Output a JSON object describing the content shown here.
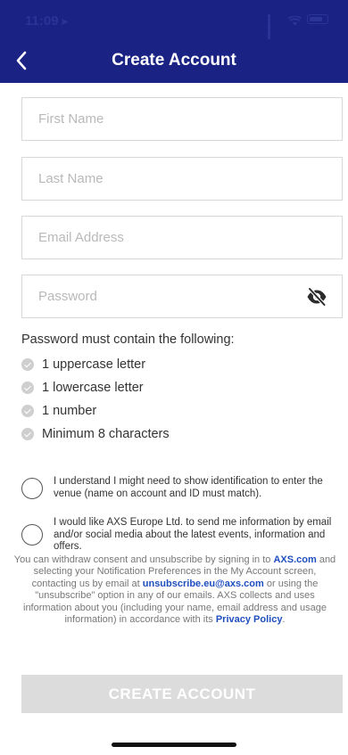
{
  "status_bar": {
    "time": "11:09"
  },
  "nav": {
    "title": "Create Account"
  },
  "form": {
    "first_name_placeholder": "First Name",
    "first_name_value": "",
    "last_name_placeholder": "Last Name",
    "last_name_value": "",
    "email_placeholder": "Email Address",
    "email_value": "",
    "password_placeholder": "Password",
    "password_value": ""
  },
  "password_rules": {
    "heading": "Password must contain the following:",
    "items": [
      "1 uppercase letter",
      "1 lowercase letter",
      "1 number",
      "Minimum 8 characters"
    ]
  },
  "consents": [
    {
      "text": "I understand I might need to show identification to enter the venue (name on account and ID must match).",
      "checked": false
    },
    {
      "text": "I would like AXS Europe Ltd. to send me information by email and/or social media about the latest events, information and offers.",
      "checked": false
    }
  ],
  "legal": {
    "part1": "You can withdraw consent and unsubscribe by signing in to ",
    "link_axs": "AXS.com",
    "part2": " and selecting your Notification Preferences in the My Account screen, contacting us by email at ",
    "link_email": "unsubscribe.eu@axs.com",
    "part3": " or using the \"unsubscribe\" option in any of our emails. AXS collects and uses information about you (including your name, email address and usage information) in accordance with its ",
    "link_privacy": "Privacy Policy",
    "part4": "."
  },
  "create_button": {
    "label": "CREATE ACCOUNT",
    "enabled": false
  },
  "colors": {
    "header_bg": "#1a2384",
    "link": "#1f4fbf",
    "button_disabled": "#dcdcdc"
  },
  "icons": {
    "back": "chevron-left-icon",
    "password_toggle": "eye-slash-icon",
    "rule_check": "check-circle-icon"
  }
}
